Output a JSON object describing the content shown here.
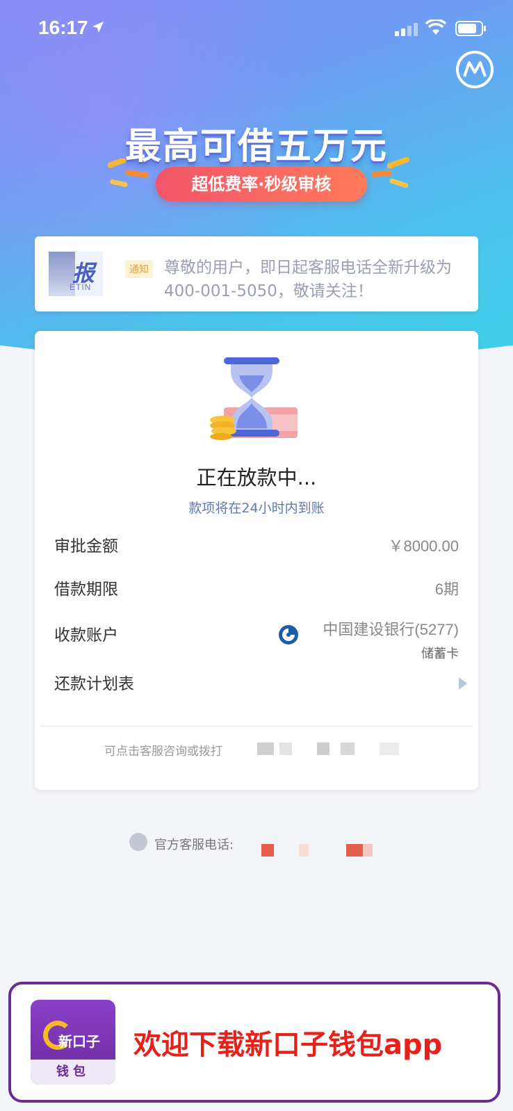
{
  "status_bar": {
    "time": "16:17"
  },
  "hero": {
    "headline": "最高可借五万元",
    "pill": "超低费率·秒级审核"
  },
  "notice": {
    "thumb_glyph": "报",
    "thumb_sub": "ETIN",
    "tag": "通知",
    "text": "尊敬的用户，即日起客服电话全新升级为400-001-5050，敬请关注！"
  },
  "loan": {
    "status_title": "正在放款中...",
    "status_sub": "款项将在24小时内到账",
    "rows": [
      {
        "label": "审批金额",
        "value": "￥8000.00"
      },
      {
        "label": "借款期限",
        "value": "6期"
      },
      {
        "label": "收款账户",
        "value": "中国建设银行(5277)",
        "sub": "储蓄卡"
      },
      {
        "label": "还款计划表"
      }
    ],
    "footer_hint": "可点击客服咨询或拨打"
  },
  "support": {
    "label": "官方客服电话:"
  },
  "banner": {
    "app_name": "新口子",
    "app_sub": "钱包",
    "text": "欢迎下载新口子钱包app"
  },
  "colors": {
    "accent": "#5f7ab0",
    "banner_red": "#e8201a",
    "banner_border": "#6a2d8f"
  }
}
